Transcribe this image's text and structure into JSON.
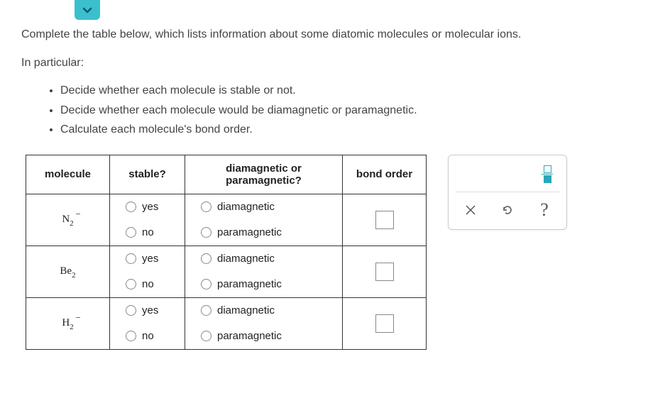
{
  "instructions": {
    "intro": "Complete the table below, which lists information about some diatomic molecules or molecular ions.",
    "particular": "In particular:",
    "bullets": [
      "Decide whether each molecule is stable or not.",
      "Decide whether each molecule would be diamagnetic or paramagnetic.",
      "Calculate each molecule's bond order."
    ]
  },
  "table": {
    "headers": {
      "molecule": "molecule",
      "stable": "stable?",
      "magnetic": "diamagnetic or paramagnetic?",
      "bond_order": "bond order"
    },
    "options": {
      "yes": "yes",
      "no": "no",
      "diamagnetic": "diamagnetic",
      "paramagnetic": "paramagnetic"
    },
    "rows": [
      {
        "base": "N",
        "sub": "2",
        "sup": "−"
      },
      {
        "base": "Be",
        "sub": "2",
        "sup": ""
      },
      {
        "base": "H",
        "sub": "2",
        "sup": "−"
      }
    ]
  }
}
